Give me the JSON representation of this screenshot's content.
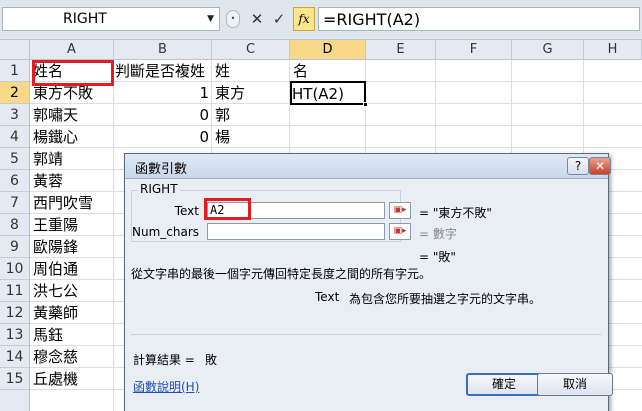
{
  "formula_bar": {
    "name_box": "RIGHT",
    "cancel_glyph": "✕",
    "confirm_glyph": "✓",
    "fx_label": "fx",
    "formula": "=RIGHT(A2)"
  },
  "sheet": {
    "columns": [
      "A",
      "B",
      "C",
      "D",
      "E",
      "F",
      "G",
      "H"
    ],
    "rows": [
      "1",
      "2",
      "3",
      "4",
      "5",
      "6",
      "7",
      "8",
      "9",
      "10",
      "11",
      "12",
      "13",
      "14",
      "15"
    ],
    "selected_column": "D",
    "selected_row": "2",
    "cells": {
      "A1": "姓名",
      "B1": "判斷是否複姓",
      "C1": "姓",
      "D1": "名",
      "A2": "東方不敗",
      "B2": "1",
      "C2": "東方",
      "D2": "HT(A2)",
      "A3": "郭嘯天",
      "B3": "0",
      "C3": "郭",
      "A4": "楊鐵心",
      "B4": "0",
      "C4": "楊",
      "A5": "郭靖",
      "A6": "黃蓉",
      "A7": "西門吹雪",
      "A8": "王重陽",
      "A9": "歐陽鋒",
      "A10": "周伯通",
      "A11": "洪七公",
      "A12": "黃藥師",
      "A13": "馬鈺",
      "A14": "穆念慈",
      "A15": "丘處機"
    }
  },
  "dialog": {
    "title": "函數引數",
    "help_glyph": "?",
    "close_glyph": "✕",
    "function_name": "RIGHT",
    "arg1_label": "Text",
    "arg1_value": "A2",
    "arg1_result": "= \"東方不敗\"",
    "arg2_label": "Num_chars",
    "arg2_value": "",
    "arg2_result": "= 數字",
    "formula_result_inline": "= \"敗\"",
    "description": "從文字串的最後一個字元傳回特定長度之間的所有字元。",
    "arg_help_name": "Text",
    "arg_help_text": "為包含您所要抽選之字元的文字串。",
    "calc_result_label": "計算結果 =",
    "calc_result_value": "敗",
    "help_link": "函數說明(H)",
    "ok_label": "確定",
    "cancel_label": "取消"
  }
}
